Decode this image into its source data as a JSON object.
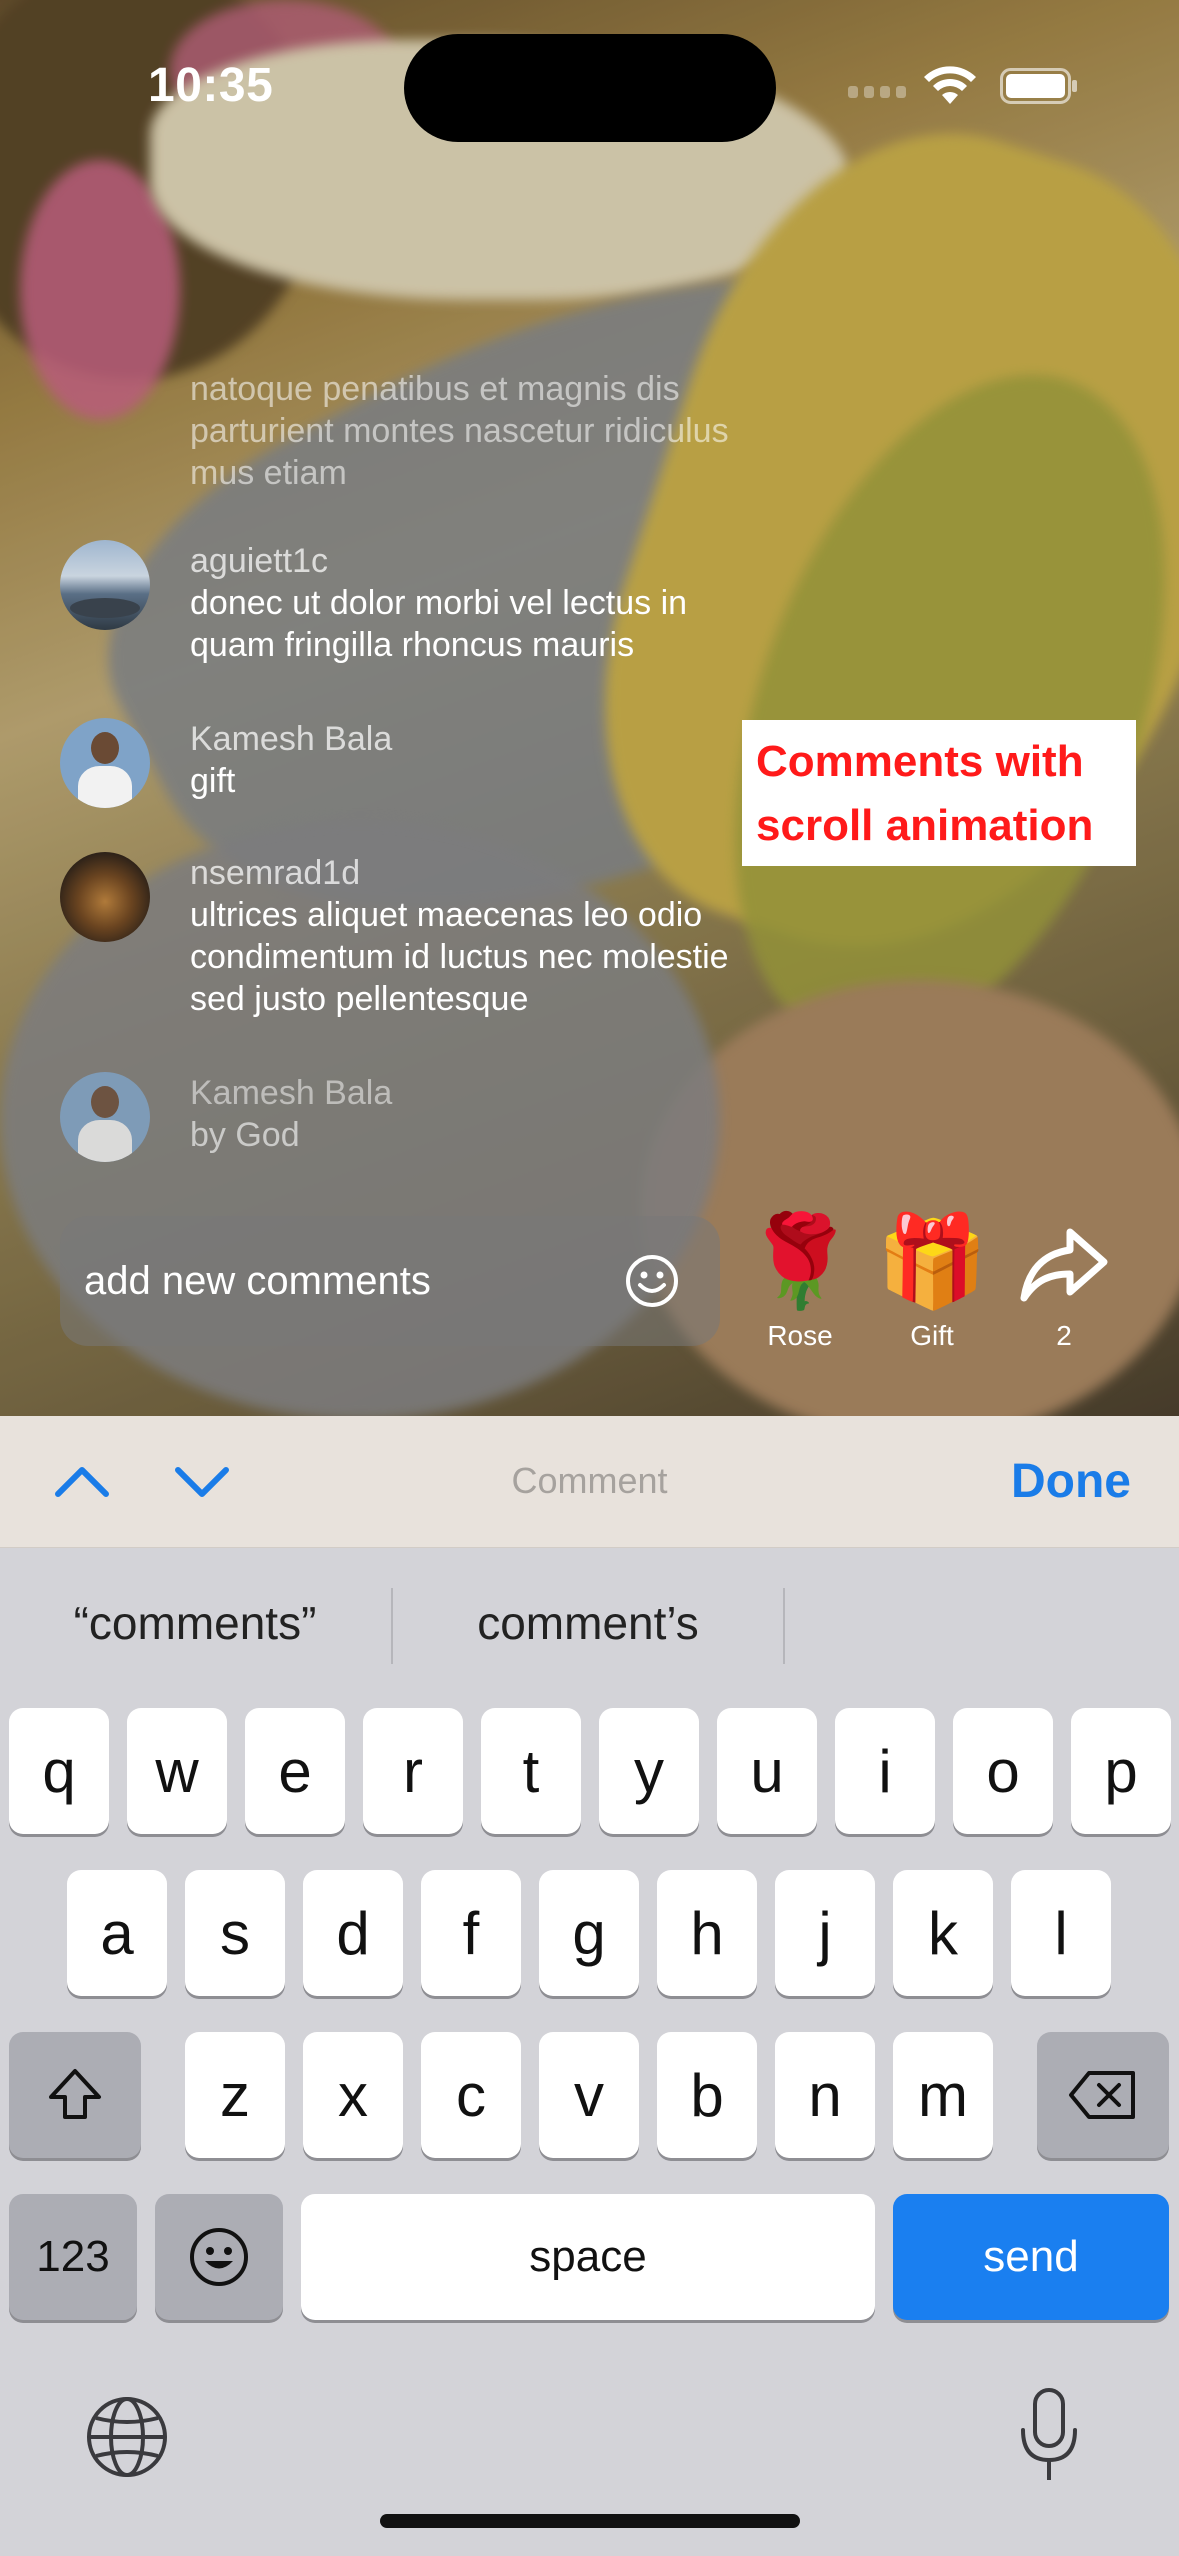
{
  "status_bar": {
    "time": "10:35"
  },
  "comments": {
    "faded_text": "natoque penatibus et magnis dis parturient montes nascetur ridiculus mus etiam",
    "items": [
      {
        "user": "aguiett1c",
        "text": "donec ut dolor morbi vel lectus in quam fringilla rhoncus mauris",
        "avatar": "lake-avatar"
      },
      {
        "user": "Kamesh Bala",
        "text": "gift",
        "avatar": "person-avatar"
      },
      {
        "user": "nsemrad1d",
        "text": "ultrices aliquet maecenas leo odio condimentum id luctus nec molestie sed justo pellentesque",
        "avatar": "tiger-avatar"
      },
      {
        "user": "Kamesh Bala",
        "text": "by God",
        "avatar": "person-avatar"
      }
    ]
  },
  "annotation": {
    "text": "Comments with scroll animation"
  },
  "input": {
    "placeholder": "add new comments"
  },
  "actions": [
    {
      "label": "Rose",
      "icon": "rose-icon",
      "glyph": "🌹"
    },
    {
      "label": "Gift",
      "icon": "gift-icon",
      "glyph": "🎁"
    },
    {
      "label": "2",
      "icon": "share-icon"
    }
  ],
  "accessory": {
    "title": "Comment",
    "done_label": "Done"
  },
  "keyboard": {
    "suggestions": [
      "“comments”",
      "comment’s"
    ],
    "row1": [
      "q",
      "w",
      "e",
      "r",
      "t",
      "y",
      "u",
      "i",
      "o",
      "p"
    ],
    "row2": [
      "a",
      "s",
      "d",
      "f",
      "g",
      "h",
      "j",
      "k",
      "l"
    ],
    "row3": [
      "z",
      "x",
      "c",
      "v",
      "b",
      "n",
      "m"
    ],
    "numbers_label": "123",
    "space_label": "space",
    "send_label": "send"
  },
  "colors": {
    "accent": "#1a7ce8",
    "send": "#1a7ff0",
    "annotation": "#ff1a1a"
  }
}
